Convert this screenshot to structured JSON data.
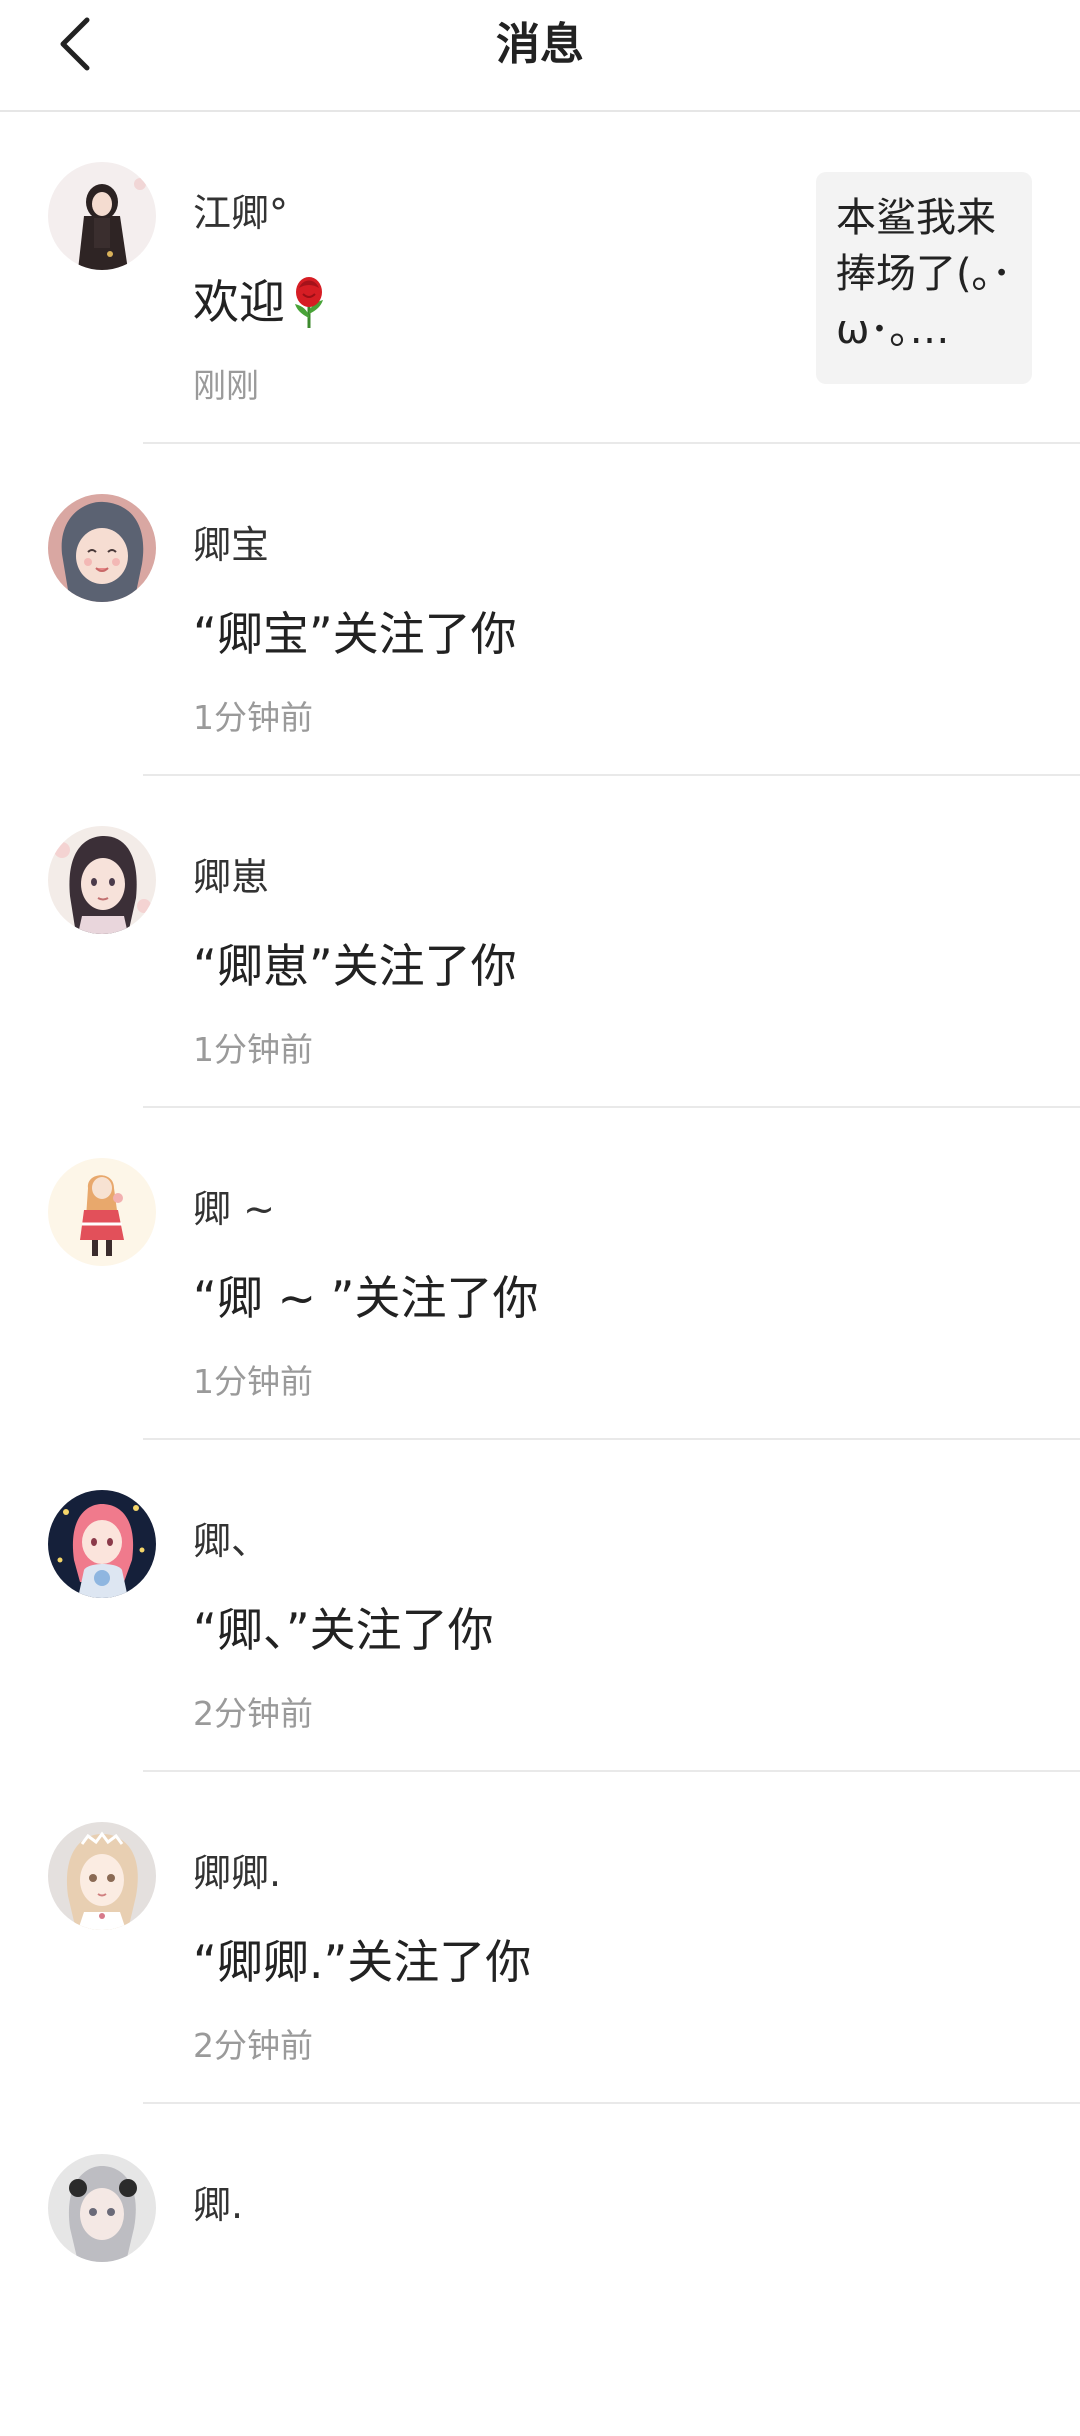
{
  "header": {
    "title": "消息",
    "back_icon": "chevron-left-icon"
  },
  "notifications": [
    {
      "name": "江卿°",
      "message": "欢迎",
      "message_emoji": "rose-icon",
      "time": "刚刚",
      "preview": "本鲨我来捧场了(｡･ω･｡…"
    },
    {
      "name": "卿宝",
      "message": "“卿宝”关注了你",
      "time": "1分钟前"
    },
    {
      "name": "卿崽",
      "message": "“卿崽”关注了你",
      "time": "1分钟前"
    },
    {
      "name": "卿 ~",
      "message": "“卿 ~ ”关注了你",
      "time": "1分钟前"
    },
    {
      "name": "卿、",
      "message": "“卿、”关注了你",
      "time": "2分钟前"
    },
    {
      "name": "卿卿.",
      "message": "“卿卿.”关注了你",
      "time": "2分钟前"
    },
    {
      "name": "卿."
    }
  ]
}
